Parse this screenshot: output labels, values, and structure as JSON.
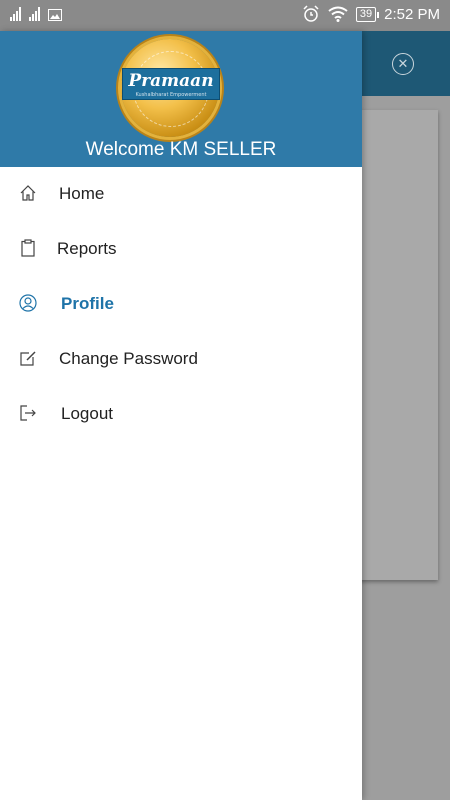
{
  "status_bar": {
    "time": "2:52 PM",
    "battery": "39"
  },
  "drawer": {
    "brand_main": "Pramaan",
    "brand_sub": "Kushalbharat Empowerment",
    "welcome": "Welcome KM SELLER",
    "items": [
      {
        "label": "Home",
        "icon": "home-icon"
      },
      {
        "label": "Reports",
        "icon": "clipboard-icon"
      },
      {
        "label": "Profile",
        "icon": "user-icon",
        "active": true
      },
      {
        "label": "Change Password",
        "icon": "edit-icon"
      },
      {
        "label": "Logout",
        "icon": "logout-icon"
      }
    ]
  },
  "colors": {
    "header": "#2f7aa8",
    "active": "#1e73a8",
    "appbar": "#1e5875"
  }
}
